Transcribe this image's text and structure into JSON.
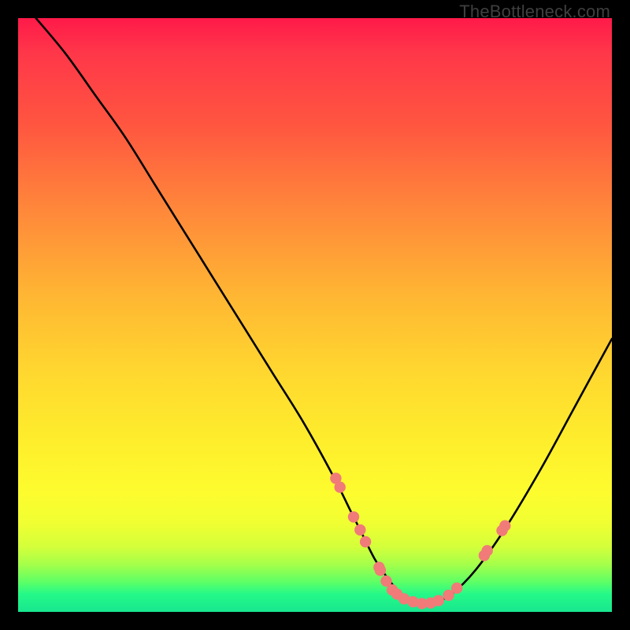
{
  "attribution": "TheBottleneck.com",
  "chart_data": {
    "type": "line",
    "title": "",
    "xlabel": "",
    "ylabel": "",
    "xlim": [
      0,
      100
    ],
    "ylim": [
      0,
      100
    ],
    "series": [
      {
        "name": "curve",
        "x": [
          3,
          8,
          13,
          18,
          23,
          28,
          33,
          38,
          43,
          48,
          53,
          56,
          58,
          60,
          62,
          64,
          66,
          68,
          70,
          73,
          77,
          82,
          88,
          94,
          100
        ],
        "y": [
          100,
          94,
          87,
          80,
          72,
          64,
          56,
          48,
          40,
          32,
          23,
          17,
          13,
          9,
          6,
          3.5,
          2,
          1.3,
          1.5,
          3,
          7,
          14,
          24,
          35,
          46
        ]
      }
    ],
    "markers": {
      "name": "dots",
      "color": "#f07b78",
      "points": [
        {
          "x": 53.5,
          "y": 22.5
        },
        {
          "x": 54.2,
          "y": 21.0
        },
        {
          "x": 56.5,
          "y": 16.0
        },
        {
          "x": 57.6,
          "y": 13.8
        },
        {
          "x": 58.5,
          "y": 11.8
        },
        {
          "x": 60.8,
          "y": 7.5
        },
        {
          "x": 61.0,
          "y": 7.0
        },
        {
          "x": 62.0,
          "y": 5.2
        },
        {
          "x": 63.0,
          "y": 3.7
        },
        {
          "x": 63.8,
          "y": 3.0
        },
        {
          "x": 65.0,
          "y": 2.2
        },
        {
          "x": 66.5,
          "y": 1.7
        },
        {
          "x": 68.0,
          "y": 1.4
        },
        {
          "x": 69.5,
          "y": 1.5
        },
        {
          "x": 70.8,
          "y": 1.9
        },
        {
          "x": 72.5,
          "y": 2.8
        },
        {
          "x": 73.9,
          "y": 4.0
        },
        {
          "x": 78.5,
          "y": 9.5
        },
        {
          "x": 79.0,
          "y": 10.3
        },
        {
          "x": 81.5,
          "y": 13.7
        },
        {
          "x": 82.0,
          "y": 14.5
        }
      ]
    }
  }
}
